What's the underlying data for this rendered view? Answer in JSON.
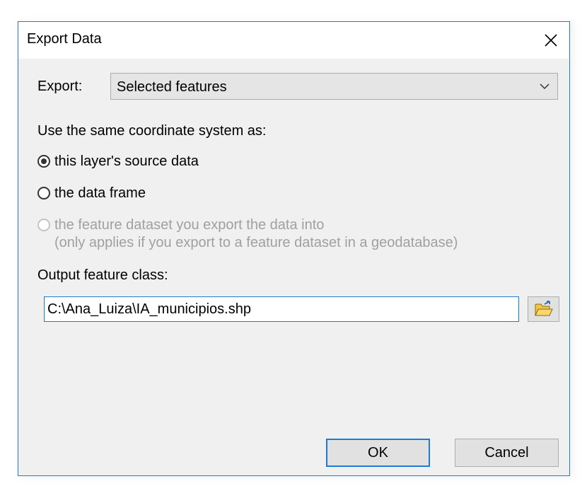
{
  "window": {
    "title": "Export Data"
  },
  "export": {
    "label": "Export:",
    "selected": "Selected features"
  },
  "coordinate": {
    "heading": "Use the same coordinate system as:",
    "options": [
      {
        "label": "this layer's source data",
        "checked": true,
        "enabled": true
      },
      {
        "label": "the data frame",
        "checked": false,
        "enabled": true
      },
      {
        "label": "the feature dataset you export the data into",
        "sublabel": "(only applies if you export to a feature dataset in a geodatabase)",
        "checked": false,
        "enabled": false
      }
    ]
  },
  "output": {
    "label": "Output feature class:",
    "value": "C:\\Ana_Luiza\\IA_municipios.shp"
  },
  "buttons": {
    "ok": "OK",
    "cancel": "Cancel"
  },
  "icons": {
    "close": "close-icon",
    "dropdown": "chevron-down-icon",
    "browse": "open-folder-icon"
  },
  "colors": {
    "accent": "#1b7bd6",
    "folder": "#f3c545"
  }
}
